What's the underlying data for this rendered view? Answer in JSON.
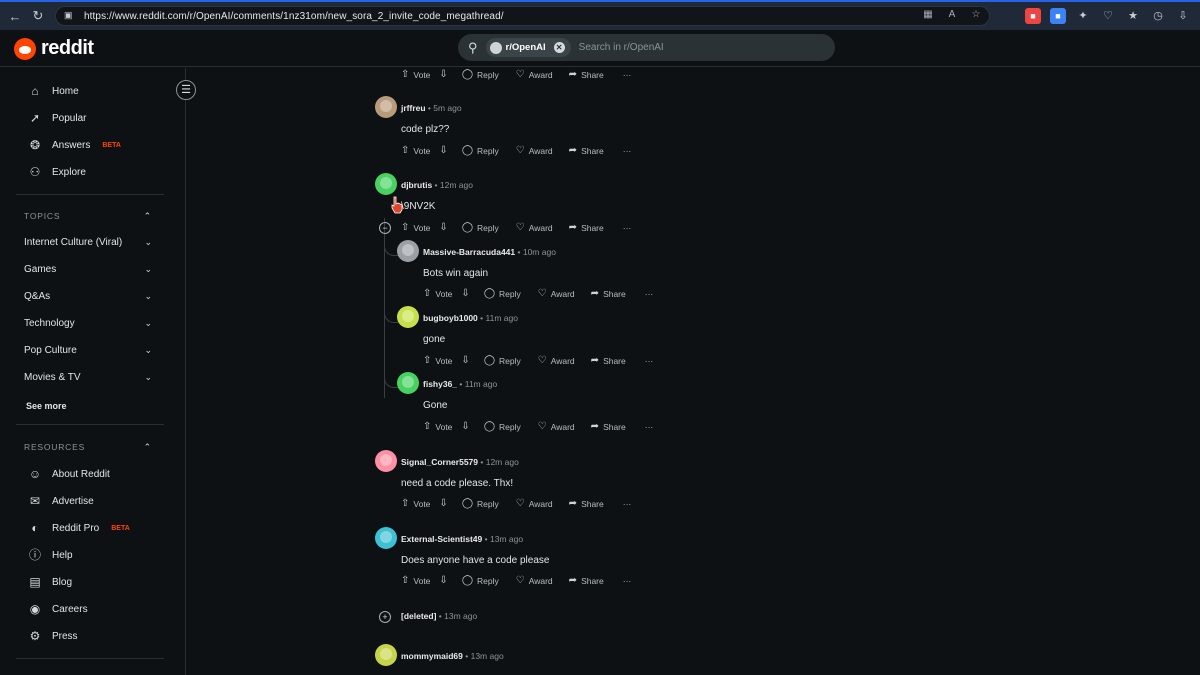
{
  "browser": {
    "url": "https://www.reddit.com/r/OpenAI/comments/1nz31om/new_sora_2_invite_code_megathread/",
    "icons": [
      "back-icon",
      "refresh-icon",
      "lock-icon"
    ]
  },
  "header": {
    "logo_text": "reddit",
    "search_chip": "r/OpenAI",
    "search_placeholder": "Search in r/OpenAI",
    "accent": "#ff4500"
  },
  "sidebar": {
    "main_items": [
      {
        "label": "Home",
        "icon": "home-icon"
      },
      {
        "label": "Popular",
        "icon": "popular-icon"
      },
      {
        "label": "Answers",
        "icon": "answers-icon",
        "badge": "BETA"
      },
      {
        "label": "Explore",
        "icon": "explore-icon"
      }
    ],
    "topics_header": "TOPICS",
    "topics": [
      "Internet Culture (Viral)",
      "Games",
      "Q&As",
      "Technology",
      "Pop Culture",
      "Movies & TV"
    ],
    "see_more": "See more",
    "resources_header": "RESOURCES",
    "resources": [
      {
        "label": "About Reddit",
        "icon": "reddit-alien-icon"
      },
      {
        "label": "Advertise",
        "icon": "megaphone-icon"
      },
      {
        "label": "Reddit Pro",
        "icon": "reddit-pro-icon",
        "badge": "BETA"
      },
      {
        "label": "Help",
        "icon": "help-icon"
      },
      {
        "label": "Blog",
        "icon": "blog-icon"
      },
      {
        "label": "Careers",
        "icon": "careers-icon"
      },
      {
        "label": "Press",
        "icon": "press-icon"
      }
    ]
  },
  "actions": {
    "vote": "Vote",
    "reply": "Reply",
    "award": "Award",
    "share": "Share",
    "more": "···"
  },
  "comments": [
    {
      "user": "jrffreu",
      "time": "5m ago",
      "text": "code plz??",
      "color": "#b79b7a"
    },
    {
      "user": "djbrutis",
      "time": "12m ago",
      "text": "\\9NV2K",
      "color": "#46d160"
    },
    {
      "user": "Massive-Barracuda441",
      "time": "10m ago",
      "text": "Bots win again",
      "color": "#9aa0a6"
    },
    {
      "user": "bugboyb1000",
      "time": "11m ago",
      "text": "gone",
      "color": "#c6e04a"
    },
    {
      "user": "fishy36_",
      "time": "11m ago",
      "text": "Gone",
      "color": "#46d160"
    },
    {
      "user": "Signal_Corner5579",
      "time": "12m ago",
      "text": "need a code please. Thx!",
      "color": "#ff8fa3"
    },
    {
      "user": "External-Scientist49",
      "time": "13m ago",
      "text": "Does anyone have a code please",
      "color": "#3fc1d4"
    },
    {
      "user": "[deleted]",
      "time": "13m ago",
      "text": "",
      "color": ""
    },
    {
      "user": "mommymaid69",
      "time": "13m ago",
      "text": "",
      "color": "#c6d44a"
    }
  ]
}
